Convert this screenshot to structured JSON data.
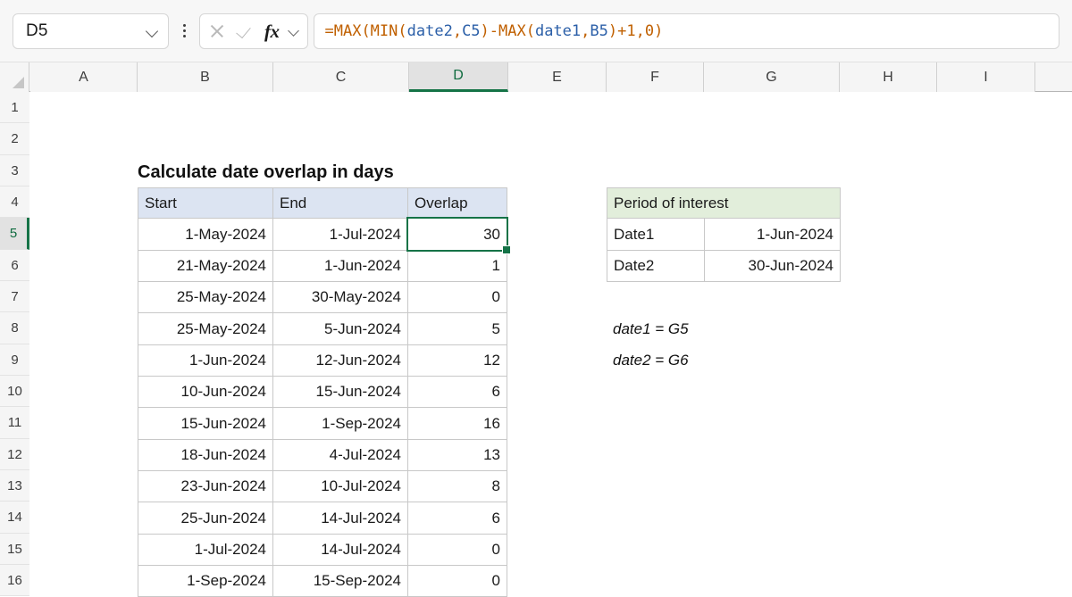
{
  "app": {
    "name_box_value": "D5",
    "formula": "=MAX(MIN(date2,C5)-MAX(date1,B5)+1,0)",
    "icons": {
      "name_box_chevron": "chevron-down-icon",
      "more_options": "kebab-menu-icon",
      "cancel": "x-icon",
      "enter": "check-icon",
      "insert_function": "fx-icon",
      "formula_expand": "chevron-down-icon",
      "select_all": "select-all-triangle-icon"
    }
  },
  "grid": {
    "column_headers": [
      "A",
      "B",
      "C",
      "D",
      "E",
      "F",
      "G",
      "H",
      "I"
    ],
    "selected_column": "D",
    "row_headers": [
      "1",
      "2",
      "3",
      "4",
      "5",
      "6",
      "7",
      "8",
      "9",
      "10",
      "11",
      "12",
      "13",
      "14",
      "15",
      "16"
    ],
    "selected_row": "5",
    "selected_cell": "D5"
  },
  "colors": {
    "table_header_fill": "#dce4f2",
    "period_header_fill": "#e2eedb",
    "selection_green": "#157347",
    "formula_orange": "#c06000",
    "formula_blue": "#2b5fa8"
  },
  "sheet": {
    "title": "Calculate date overlap in days",
    "main_table": {
      "headers": [
        "Start",
        "End",
        "Overlap"
      ],
      "rows": [
        {
          "start": "1-May-2024",
          "end": "1-Jul-2024",
          "overlap": "30"
        },
        {
          "start": "21-May-2024",
          "end": "1-Jun-2024",
          "overlap": "1"
        },
        {
          "start": "25-May-2024",
          "end": "30-May-2024",
          "overlap": "0"
        },
        {
          "start": "25-May-2024",
          "end": "5-Jun-2024",
          "overlap": "5"
        },
        {
          "start": "1-Jun-2024",
          "end": "12-Jun-2024",
          "overlap": "12"
        },
        {
          "start": "10-Jun-2024",
          "end": "15-Jun-2024",
          "overlap": "6"
        },
        {
          "start": "15-Jun-2024",
          "end": "1-Sep-2024",
          "overlap": "16"
        },
        {
          "start": "18-Jun-2024",
          "end": "4-Jul-2024",
          "overlap": "13"
        },
        {
          "start": "23-Jun-2024",
          "end": "10-Jul-2024",
          "overlap": "8"
        },
        {
          "start": "25-Jun-2024",
          "end": "14-Jul-2024",
          "overlap": "6"
        },
        {
          "start": "1-Jul-2024",
          "end": "14-Jul-2024",
          "overlap": "0"
        },
        {
          "start": "1-Sep-2024",
          "end": "15-Sep-2024",
          "overlap": "0"
        }
      ]
    },
    "period_table": {
      "header": "Period of interest",
      "rows": [
        {
          "label": "Date1",
          "value": "1-Jun-2024"
        },
        {
          "label": "Date2",
          "value": "30-Jun-2024"
        }
      ]
    },
    "notes": [
      "date1 = G5",
      "date2 = G6"
    ]
  }
}
